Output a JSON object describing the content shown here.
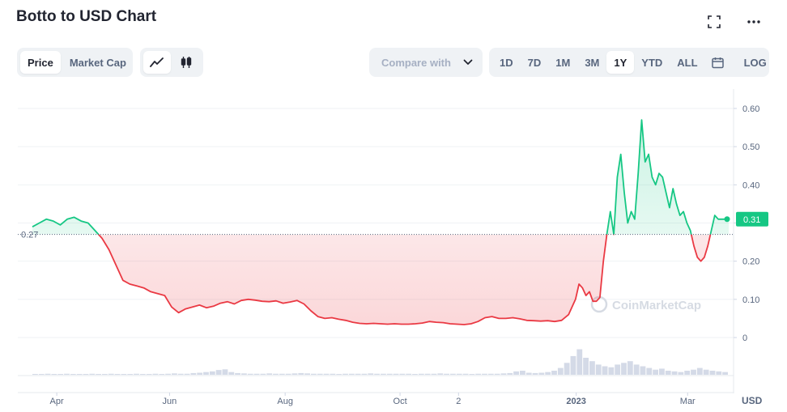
{
  "title": "Botto to USD Chart",
  "toolbar": {
    "metric_tabs": [
      "Price",
      "Market Cap"
    ],
    "active_metric": "Price",
    "compare_placeholder": "Compare with",
    "ranges": [
      "1D",
      "7D",
      "1M",
      "3M",
      "1Y",
      "YTD",
      "ALL"
    ],
    "active_range": "1Y",
    "log_label": "LOG"
  },
  "icons": {
    "fullscreen": "fullscreen-icon",
    "more": "more-icon",
    "line_chart": "line-chart-icon",
    "candlestick": "candlestick-icon",
    "dropdown": "chevron-down-icon",
    "calendar": "calendar-icon"
  },
  "colors": {
    "up": "#16c784",
    "down": "#ea3943",
    "grid": "#eff2f5",
    "text": "#58667e",
    "price_badge": "#16c784"
  },
  "watermark": "CoinMarketCap",
  "chart_data": {
    "type": "line",
    "currency_label": "USD",
    "baseline_value": 0.27,
    "baseline_label": "0.27",
    "last_value": 0.31,
    "last_label": "0.31",
    "ylim": [
      0,
      0.6
    ],
    "y_ticks": [
      0,
      0.1,
      0.2,
      0.3,
      0.4,
      0.5,
      0.6
    ],
    "y_tick_labels": [
      "0",
      "0.10",
      "0.20",
      "0.30",
      "0.40",
      "0.50",
      "0.60"
    ],
    "x_tick_labels": [
      {
        "label": "Apr",
        "t": 0.035,
        "bold": false
      },
      {
        "label": "Jun",
        "t": 0.197,
        "bold": false
      },
      {
        "label": "Aug",
        "t": 0.363,
        "bold": false
      },
      {
        "label": "Oct",
        "t": 0.528,
        "bold": false
      },
      {
        "label": "2",
        "t": 0.612,
        "bold": false
      },
      {
        "label": "2023",
        "t": 0.781,
        "bold": true
      },
      {
        "label": "Mar",
        "t": 0.941,
        "bold": false
      }
    ],
    "series": [
      {
        "t": [
          0.0,
          0.01,
          0.02,
          0.03,
          0.04,
          0.05,
          0.06,
          0.07,
          0.08,
          0.09,
          0.1,
          0.11,
          0.12,
          0.13,
          0.14,
          0.15,
          0.16,
          0.17,
          0.18,
          0.19,
          0.2,
          0.21,
          0.22,
          0.23,
          0.24,
          0.25,
          0.26,
          0.27,
          0.28,
          0.29,
          0.3,
          0.31,
          0.32,
          0.33,
          0.34,
          0.35,
          0.36,
          0.37,
          0.38,
          0.39,
          0.4,
          0.41,
          0.42,
          0.43,
          0.44,
          0.45,
          0.46,
          0.47,
          0.48,
          0.49,
          0.5,
          0.51,
          0.52,
          0.53,
          0.54,
          0.55,
          0.56,
          0.57,
          0.58,
          0.59,
          0.6,
          0.61,
          0.62,
          0.63,
          0.64,
          0.65,
          0.66,
          0.67,
          0.68,
          0.69,
          0.7,
          0.71,
          0.72,
          0.73,
          0.74,
          0.75,
          0.76,
          0.77,
          0.78,
          0.785,
          0.79,
          0.795,
          0.8,
          0.805,
          0.81,
          0.815,
          0.82,
          0.825,
          0.83,
          0.835,
          0.84,
          0.845,
          0.85,
          0.855,
          0.86,
          0.865,
          0.87,
          0.875,
          0.88,
          0.885,
          0.89,
          0.895,
          0.9,
          0.905,
          0.91,
          0.915,
          0.92,
          0.925,
          0.93,
          0.935,
          0.94,
          0.945,
          0.95,
          0.955,
          0.96,
          0.965,
          0.97,
          0.975,
          0.98,
          0.985,
          0.99,
          1.0
        ],
        "values": [
          0.29,
          0.3,
          0.31,
          0.305,
          0.295,
          0.31,
          0.315,
          0.305,
          0.3,
          0.28,
          0.26,
          0.23,
          0.19,
          0.15,
          0.14,
          0.135,
          0.13,
          0.12,
          0.115,
          0.11,
          0.08,
          0.065,
          0.075,
          0.08,
          0.085,
          0.078,
          0.082,
          0.09,
          0.094,
          0.088,
          0.097,
          0.1,
          0.098,
          0.095,
          0.094,
          0.096,
          0.09,
          0.093,
          0.097,
          0.088,
          0.07,
          0.055,
          0.05,
          0.052,
          0.048,
          0.045,
          0.04,
          0.037,
          0.036,
          0.037,
          0.036,
          0.035,
          0.036,
          0.035,
          0.035,
          0.036,
          0.038,
          0.042,
          0.04,
          0.039,
          0.036,
          0.035,
          0.034,
          0.036,
          0.042,
          0.052,
          0.055,
          0.05,
          0.05,
          0.052,
          0.049,
          0.045,
          0.044,
          0.043,
          0.044,
          0.042,
          0.045,
          0.06,
          0.1,
          0.14,
          0.13,
          0.11,
          0.12,
          0.095,
          0.095,
          0.105,
          0.2,
          0.27,
          0.33,
          0.27,
          0.42,
          0.48,
          0.38,
          0.3,
          0.33,
          0.31,
          0.43,
          0.57,
          0.46,
          0.48,
          0.42,
          0.4,
          0.43,
          0.42,
          0.38,
          0.34,
          0.39,
          0.35,
          0.32,
          0.33,
          0.3,
          0.28,
          0.24,
          0.21,
          0.2,
          0.21,
          0.24,
          0.28,
          0.32,
          0.31,
          0.31,
          0.31
        ]
      }
    ],
    "volume": {
      "values": [
        0.02,
        0.02,
        0.03,
        0.02,
        0.02,
        0.03,
        0.02,
        0.02,
        0.02,
        0.03,
        0.02,
        0.02,
        0.03,
        0.02,
        0.02,
        0.02,
        0.03,
        0.02,
        0.02,
        0.03,
        0.02,
        0.03,
        0.04,
        0.03,
        0.03,
        0.05,
        0.06,
        0.08,
        0.1,
        0.14,
        0.16,
        0.08,
        0.05,
        0.04,
        0.03,
        0.03,
        0.03,
        0.04,
        0.03,
        0.03,
        0.03,
        0.04,
        0.05,
        0.04,
        0.03,
        0.03,
        0.03,
        0.03,
        0.02,
        0.03,
        0.03,
        0.03,
        0.03,
        0.04,
        0.03,
        0.03,
        0.03,
        0.03,
        0.03,
        0.03,
        0.02,
        0.03,
        0.03,
        0.03,
        0.04,
        0.03,
        0.03,
        0.03,
        0.03,
        0.02,
        0.03,
        0.03,
        0.03,
        0.03,
        0.04,
        0.05,
        0.1,
        0.12,
        0.06,
        0.05,
        0.06,
        0.08,
        0.12,
        0.2,
        0.35,
        0.55,
        0.75,
        0.5,
        0.4,
        0.3,
        0.25,
        0.22,
        0.3,
        0.35,
        0.4,
        0.3,
        0.25,
        0.2,
        0.15,
        0.18,
        0.12,
        0.1,
        0.08,
        0.12,
        0.15,
        0.2,
        0.15,
        0.12,
        0.1,
        0.08
      ]
    }
  }
}
